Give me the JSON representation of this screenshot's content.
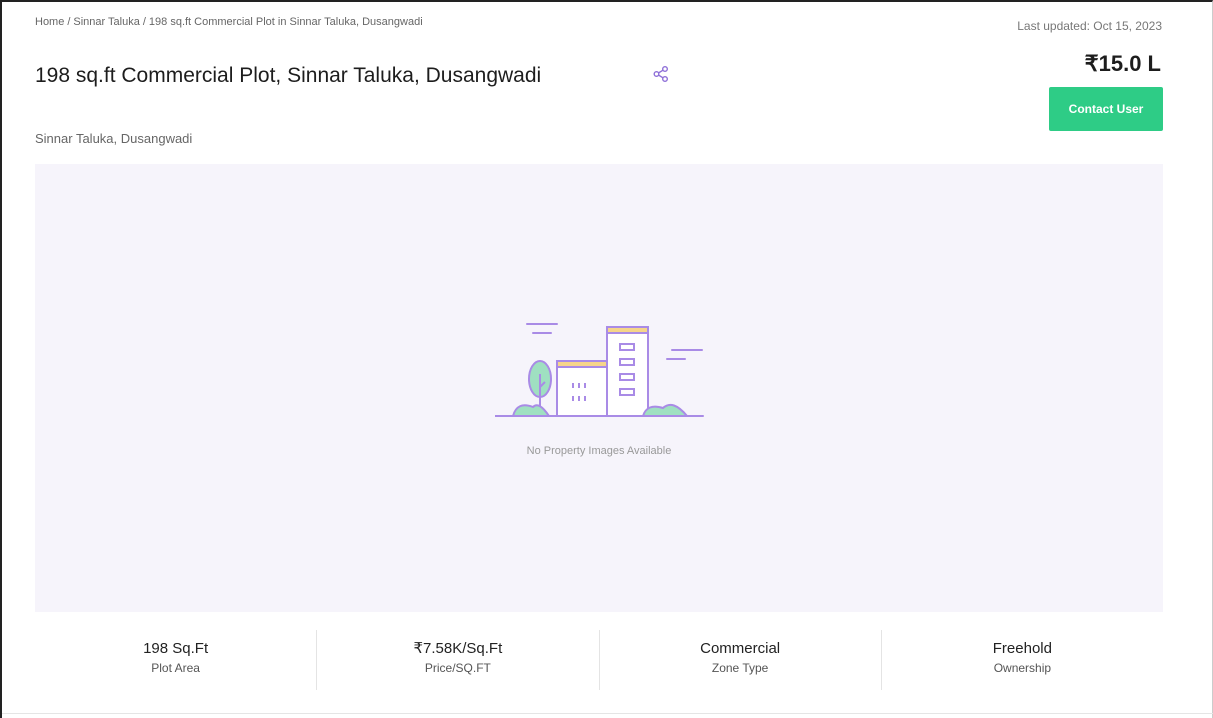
{
  "breadcrumb": {
    "home": "Home",
    "taluka": "Sinnar Taluka",
    "current": "198 sq.ft Commercial Plot in Sinnar Taluka, Dusangwadi",
    "separator": "/"
  },
  "last_updated": "Last updated: Oct 15, 2023",
  "listing": {
    "title": "198 sq.ft Commercial Plot, Sinnar Taluka, Dusangwadi",
    "location": "Sinnar Taluka, Dusangwadi",
    "price": "₹15.0 L",
    "contact_label": "Contact User"
  },
  "gallery": {
    "empty_message": "No Property Images Available",
    "icon": "building-placeholder-icon"
  },
  "colors": {
    "accent_green": "#2ecc86",
    "purple": "#a98be6",
    "gallery_bg": "#f6f4fb"
  },
  "stats": [
    {
      "value": "198 Sq.Ft",
      "label": "Plot Area"
    },
    {
      "value": "₹7.58K/Sq.Ft",
      "label": "Price/SQ.FT"
    },
    {
      "value": "Commercial",
      "label": "Zone Type"
    },
    {
      "value": "Freehold",
      "label": "Ownership"
    }
  ]
}
